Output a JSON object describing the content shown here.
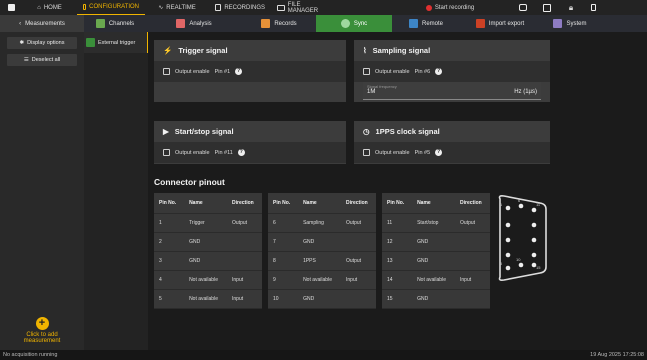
{
  "top_tabs": [
    {
      "label": "",
      "icon": "app-icon"
    },
    {
      "label": "HOME",
      "icon": "home-icon"
    },
    {
      "label": "CONFIGURATION",
      "icon": "config-icon",
      "active": true
    },
    {
      "label": "REALTIME",
      "icon": "realtime-icon"
    },
    {
      "label": "RECORDINGS",
      "icon": "recordings-icon"
    },
    {
      "label": "FILE MANAGER",
      "icon": "folder-icon"
    }
  ],
  "record_label": "Start recording",
  "sub_tabs": [
    {
      "label": "Measurements",
      "icon": "chevron-left-icon"
    },
    {
      "label": "Channels",
      "icon": "channels-icon"
    },
    {
      "label": "Analysis",
      "icon": "analysis-icon"
    },
    {
      "label": "Records",
      "icon": "records-icon"
    },
    {
      "label": "Sync",
      "icon": "sync-icon",
      "active": true
    },
    {
      "label": "Remote",
      "icon": "remote-icon"
    },
    {
      "label": "Import export",
      "icon": "import-export-icon"
    },
    {
      "label": "System",
      "icon": "gear-icon"
    }
  ],
  "sidebar": {
    "display_options": "Display options",
    "deselect_all": "Deselect all",
    "add_label_1": "Click to add",
    "add_label_2": "measurement"
  },
  "sync_item": "External trigger",
  "panels": {
    "trigger": {
      "title": "Trigger signal",
      "label": "Output enable",
      "pin": "Pin #1"
    },
    "sampling": {
      "title": "Sampling signal",
      "label": "Output enable",
      "pin": "Pin #6",
      "freq_label": "Signal frequency",
      "freq_value": "1M",
      "freq_unit": "Hz (1µs)"
    },
    "startstop": {
      "title": "Start/stop signal",
      "label": "Output enable",
      "pin": "Pin #11"
    },
    "pps": {
      "title": "1PPS clock signal",
      "label": "Output enable",
      "pin": "Pin #5"
    }
  },
  "pinout_title": "Connector pinout",
  "columns": [
    "Pin No.",
    "Name",
    "Direction"
  ],
  "tables": [
    [
      [
        "1",
        "Trigger",
        "Output"
      ],
      [
        "2",
        "GND",
        ""
      ],
      [
        "3",
        "GND",
        ""
      ],
      [
        "4",
        "Not available",
        "Input"
      ],
      [
        "5",
        "Not available",
        "Input"
      ]
    ],
    [
      [
        "6",
        "Sampling",
        "Output"
      ],
      [
        "7",
        "GND",
        ""
      ],
      [
        "8",
        "1PPS",
        "Output"
      ],
      [
        "9",
        "Not available",
        "Input"
      ],
      [
        "10",
        "GND",
        ""
      ]
    ],
    [
      [
        "11",
        "Start/stop",
        "Output"
      ],
      [
        "12",
        "GND",
        ""
      ],
      [
        "13",
        "GND",
        ""
      ],
      [
        "14",
        "Not available",
        "Input"
      ],
      [
        "15",
        "GND",
        ""
      ]
    ]
  ],
  "connector_labels": [
    "1",
    "6",
    "11",
    "5",
    "10",
    "15"
  ],
  "status": {
    "left": "No acquisition running",
    "right": "19 Aug 2025 17:25:08"
  },
  "colors": {
    "accent": "#f0b400",
    "record": "#e03030",
    "sync": "#3a8f3a"
  }
}
